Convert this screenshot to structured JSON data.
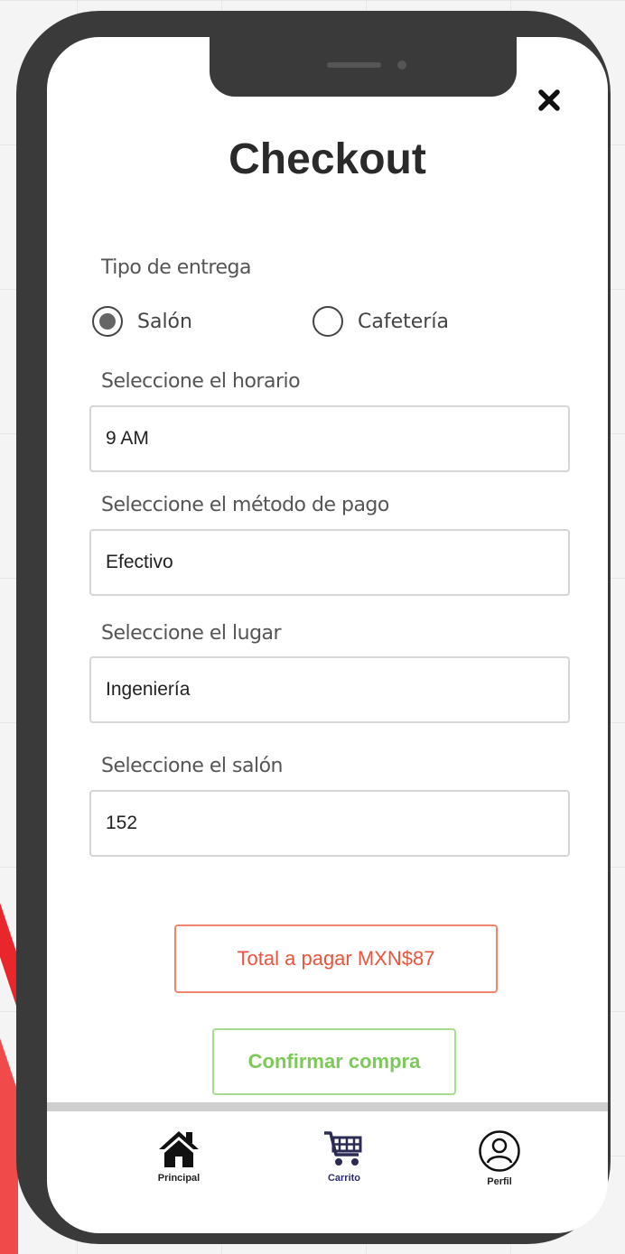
{
  "page": {
    "title": "Checkout",
    "close_icon": "close-icon"
  },
  "delivery": {
    "label": "Tipo de entrega",
    "options": [
      {
        "label": "Salón",
        "selected": true
      },
      {
        "label": "Cafetería",
        "selected": false
      }
    ]
  },
  "schedule": {
    "label": "Seleccione el horario",
    "value": "9 AM"
  },
  "payment": {
    "label": "Seleccione el método de pago",
    "value": "Efectivo"
  },
  "place": {
    "label": "Seleccione el lugar",
    "value": "Ingeniería"
  },
  "room": {
    "label": "Seleccione el salón",
    "value": "152"
  },
  "total": {
    "text": "Total a pagar MXN$87"
  },
  "confirm": {
    "label": "Confirmar compra"
  },
  "nav": {
    "items": [
      {
        "label": "Principal",
        "icon": "home-icon"
      },
      {
        "label": "Carrito",
        "icon": "cart-icon",
        "active": true
      },
      {
        "label": "Perfil",
        "icon": "user-icon"
      }
    ]
  },
  "colors": {
    "total_accent": "#e8543c",
    "confirm_accent": "#7dc957",
    "active_nav": "#2b2b7a",
    "phone_frame": "#3a3a3a"
  }
}
